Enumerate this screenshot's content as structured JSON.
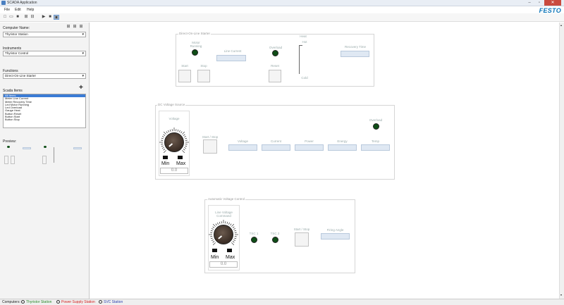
{
  "window": {
    "title": "SCADA Application"
  },
  "menu": [
    "File",
    "Edit",
    "Help"
  ],
  "brand": {
    "logo": "FESTO"
  },
  "sidebar": {
    "computer_label": "Computer Name:",
    "computer_value": "Thyristor Station",
    "instruments_label": "Instruments",
    "instruments_value": "Thyristor Control",
    "functions_label": "Functions",
    "functions_value": "Direct-On-Line Starter",
    "scada_label": "Scada Items",
    "items": [
      "All Items",
      "Meter Line Current",
      "Meter Recovery Time",
      "Led Motor Running",
      "Led Overload",
      "Gauge Heat",
      "Button Reset",
      "Button Start",
      "Button Stop"
    ],
    "preview_label": "Preview:"
  },
  "dol": {
    "title": "Direct-On-Line Starter",
    "motor_running": "Motor Running",
    "line_current": "Line Current",
    "overload": "Overload",
    "heat": "Heat",
    "hot": "Hot",
    "cold": "Cold",
    "recovery_time": "Recovery Time",
    "start": "Start",
    "stop": "Stop",
    "reset": "Reset"
  },
  "dc": {
    "title": "DC Voltage Source",
    "voltage_knob": "Voltage",
    "min": "Min",
    "max": "Max",
    "value": "0.0",
    "start_stop": "Start / Stop",
    "meters": [
      "Voltage",
      "Current",
      "Power",
      "Energy",
      "Temp"
    ],
    "overload": "Overload"
  },
  "avc": {
    "title": "Automatic Voltage Control",
    "knob_label": "Line Voltage Command",
    "min": "Min",
    "max": "Max",
    "value": "0.0",
    "tsc1": "TSC 1",
    "tsc2": "TSC 2",
    "start_stop": "Start / Stop",
    "firing_angle": "Firing Angle"
  },
  "status": {
    "label": "Computers:",
    "stations": [
      {
        "name": "Thyristor Station",
        "color": "#2a8a2a"
      },
      {
        "name": "Power Supply Station",
        "color": "#d42020"
      },
      {
        "name": "SVC Station",
        "color": "#2a3fb0"
      }
    ]
  }
}
